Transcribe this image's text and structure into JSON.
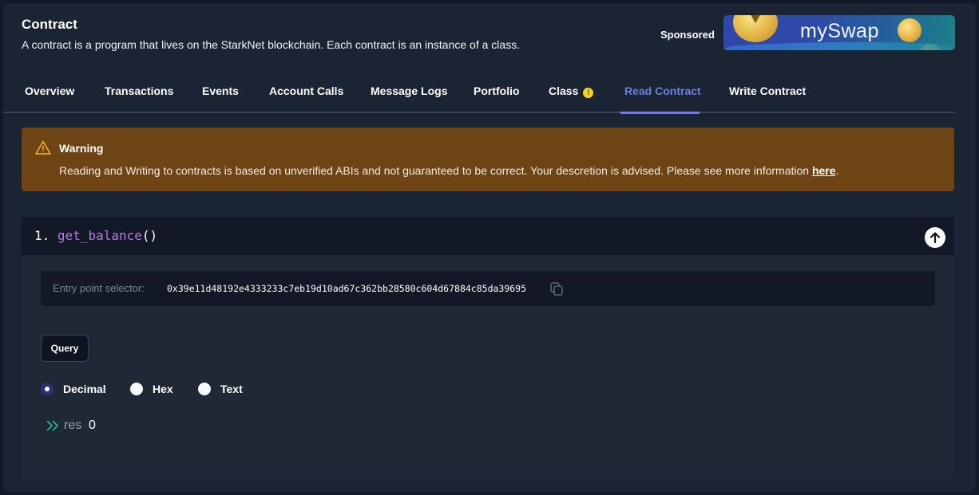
{
  "header": {
    "title": "Contract",
    "subtitle": "A contract is a program that lives on the StarkNet blockchain. Each contract is an instance of a class."
  },
  "sponsor": {
    "label": "Sponsored",
    "banner_text": "mySwap"
  },
  "tabs": [
    {
      "label": "Overview",
      "active": false
    },
    {
      "label": "Transactions",
      "active": false
    },
    {
      "label": "Events",
      "active": false
    },
    {
      "label": "Account Calls",
      "active": false
    },
    {
      "label": "Message Logs",
      "active": false
    },
    {
      "label": "Portfolio",
      "active": false
    },
    {
      "label": "Class",
      "active": false,
      "badge": "!"
    },
    {
      "label": "Read Contract",
      "active": true
    },
    {
      "label": "Write Contract",
      "active": false
    }
  ],
  "alert": {
    "title": "Warning",
    "text": "Reading and Writing to contracts is based on unverified ABIs and not guaranteed to be correct. Your descretion is advised. Please see more information ",
    "link_label": "here",
    "text_end": ".",
    "bg_color": "#6f4414"
  },
  "function": {
    "index": "1.",
    "name": "get_balance",
    "parens": "()",
    "selector_label": "Entry point selector:",
    "selector_value": "0x39e11d48192e4333233c7eb19d10ad67c362bb28580c604d67884c85da39695",
    "query_label": "Query",
    "formats": [
      {
        "label": "Decimal",
        "checked": true
      },
      {
        "label": "Hex",
        "checked": false
      },
      {
        "label": "Text",
        "checked": false
      }
    ],
    "result": {
      "key": "res",
      "value": "0"
    }
  },
  "colors": {
    "accent": "#6c7fe4",
    "function_name": "#b57be0",
    "result_arrow": "#2bb58a"
  }
}
